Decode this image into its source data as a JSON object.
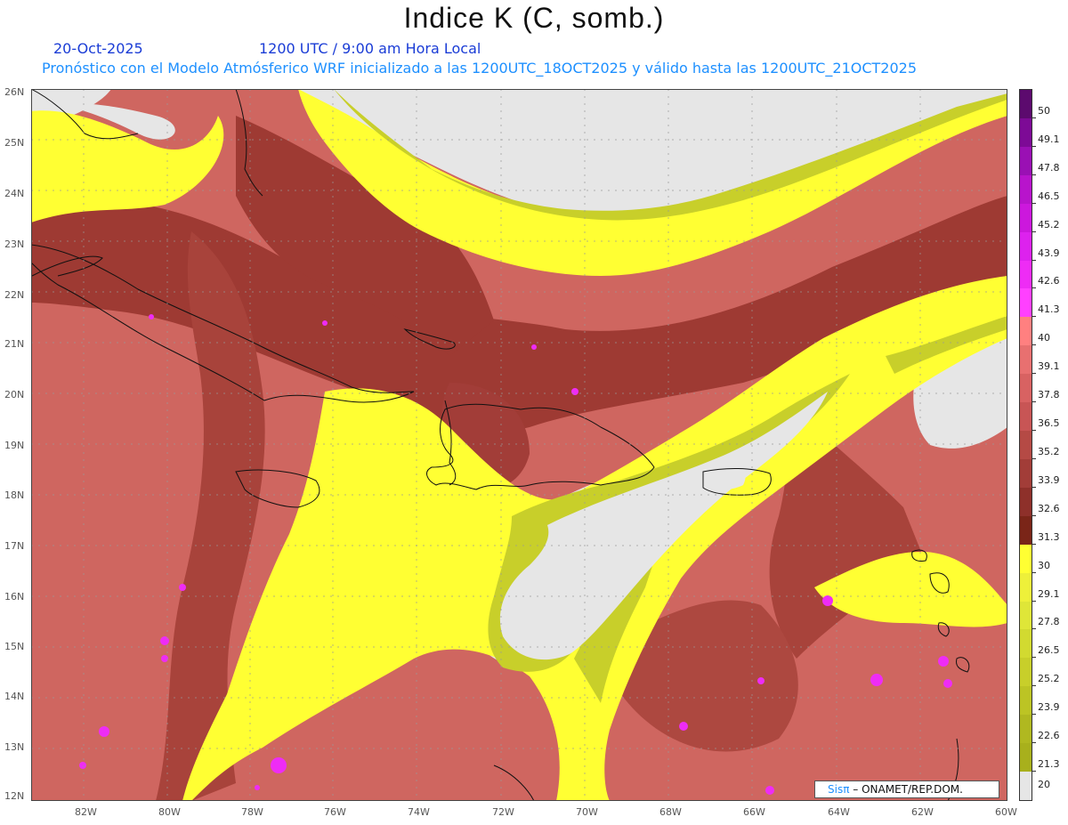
{
  "header": {
    "title": "Indice K (C, somb.)",
    "date": "20-Oct-2025",
    "time": "1200 UTC / 9:00 am Hora Local",
    "forecast": "Pronóstico con el Modelo Atmósferico WRF inicializado a las 1200UTC_18OCT2025 y válido hasta las  1200UTC_21OCT2025"
  },
  "map": {
    "lat_labels": [
      "26N",
      "25N",
      "24N",
      "23N",
      "22N",
      "21N",
      "20N",
      "19N",
      "18N",
      "17N",
      "16N",
      "15N",
      "14N",
      "13N",
      "12N"
    ],
    "lon_labels": [
      "82W",
      "80W",
      "78W",
      "76W",
      "74W",
      "72W",
      "70W",
      "68W",
      "66W",
      "64W",
      "62W",
      "60W"
    ],
    "lat_range": [
      12,
      26
    ],
    "lon_range": [
      -83.2,
      -60
    ],
    "background_color": "#cf6660"
  },
  "colorbar": {
    "labels": [
      "50",
      "49.1",
      "47.8",
      "46.5",
      "45.2",
      "43.9",
      "42.6",
      "41.3",
      "40",
      "39.1",
      "37.8",
      "36.5",
      "35.2",
      "33.9",
      "32.6",
      "31.3",
      "30",
      "29.1",
      "27.8",
      "26.5",
      "25.2",
      "23.9",
      "22.6",
      "21.3",
      "20"
    ],
    "colors": [
      "#5c0a6e",
      "#7d0a96",
      "#9a10b4",
      "#b814cc",
      "#cc18dd",
      "#dd22ee",
      "#ee2cf5",
      "#ff40ff",
      "#ff8080",
      "#e87070",
      "#d86262",
      "#c85555",
      "#b54a45",
      "#a23d38",
      "#8e302a",
      "#7a2518",
      "#ffff33",
      "#eef03a",
      "#dfe638",
      "#d2da30",
      "#c8cf2a",
      "#bcc424",
      "#b0b820",
      "#a8b01c",
      "#e6e6e6"
    ]
  },
  "credit": {
    "brand": "Sisπ",
    "text": "– ONAMET/REP.DOM."
  }
}
